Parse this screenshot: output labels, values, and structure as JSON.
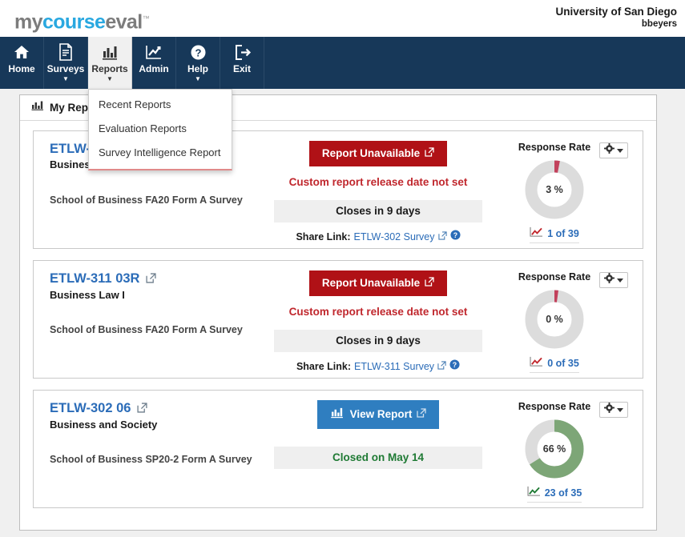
{
  "header": {
    "logo": {
      "part1": "my",
      "part2": "course",
      "part3": "eval",
      "tm": "™"
    },
    "university": "University of San Diego",
    "username": "bbeyers"
  },
  "nav": {
    "items": [
      {
        "label": "Home",
        "icon": "home-icon",
        "caret": false,
        "active": false
      },
      {
        "label": "Surveys",
        "icon": "document-icon",
        "caret": true,
        "active": false
      },
      {
        "label": "Reports",
        "icon": "bar-chart-icon",
        "caret": true,
        "active": true
      },
      {
        "label": "Admin",
        "icon": "line-chart-icon",
        "caret": false,
        "active": false
      },
      {
        "label": "Help",
        "icon": "question-icon",
        "caret": true,
        "active": false
      },
      {
        "label": "Exit",
        "icon": "exit-icon",
        "caret": false,
        "active": false
      }
    ]
  },
  "dropdown": {
    "open": true,
    "items": [
      {
        "label": "Recent Reports"
      },
      {
        "label": "Evaluation Reports"
      },
      {
        "label": "Survey Intelligence Report"
      }
    ]
  },
  "panel": {
    "title": "My Reports",
    "icon": "bar-chart-icon"
  },
  "colors": {
    "nav_bg": "#173859",
    "link_blue": "#2b6cb8",
    "danger_red": "#b01116",
    "note_red": "#c0272d",
    "primary_blue": "#2f7ec0",
    "gauge_red": "#c2415c",
    "gauge_green": "#7da677",
    "gauge_track": "#dcdcdc",
    "closed_green": "#1f7a34"
  },
  "cards": [
    {
      "code": "ETLW-",
      "course_name": "Busines",
      "school": "School of Business FA20 Form A Survey",
      "button": {
        "label": "Report Unavailable",
        "style": "unavailable",
        "icon": "external-link-icon"
      },
      "note": "Custom report release date not set",
      "status": "Closes in 9 days",
      "status_style": "neutral",
      "share_label": "Share Link:",
      "share_link": "ETLW-302 Survey",
      "help_icon": "help-circle-icon",
      "response_rate": {
        "title": "Response Rate",
        "percent_label": "3 %",
        "percent": 3,
        "color": "red",
        "count_label": "1 of 39",
        "icon": "trend-up-icon"
      },
      "gear": {
        "icon": "gear-icon",
        "caret": "chevron-down-icon"
      }
    },
    {
      "code": "ETLW-311 03R",
      "course_name": "Business Law I",
      "school": "School of Business FA20 Form A Survey",
      "button": {
        "label": "Report Unavailable",
        "style": "unavailable",
        "icon": "external-link-icon"
      },
      "note": "Custom report release date not set",
      "status": "Closes in 9 days",
      "status_style": "neutral",
      "share_label": "Share Link:",
      "share_link": "ETLW-311 Survey",
      "help_icon": "help-circle-icon",
      "response_rate": {
        "title": "Response Rate",
        "percent_label": "0 %",
        "percent": 0,
        "color": "red",
        "count_label": "0 of 35",
        "icon": "trend-up-icon"
      },
      "gear": {
        "icon": "gear-icon",
        "caret": "chevron-down-icon"
      }
    },
    {
      "code": "ETLW-302 06",
      "course_name": "Business and Society",
      "school": "School of Business SP20-2 Form A Survey",
      "button": {
        "label": "View Report",
        "style": "view",
        "icon": "external-link-icon"
      },
      "note": "",
      "status": "Closed on May 14",
      "status_style": "green",
      "share_label": "",
      "share_link": "",
      "help_icon": "",
      "response_rate": {
        "title": "Response Rate",
        "percent_label": "66 %",
        "percent": 66,
        "color": "green",
        "count_label": "23 of 35",
        "icon": "trend-up-icon"
      },
      "gear": {
        "icon": "gear-icon",
        "caret": "chevron-down-icon"
      }
    }
  ]
}
